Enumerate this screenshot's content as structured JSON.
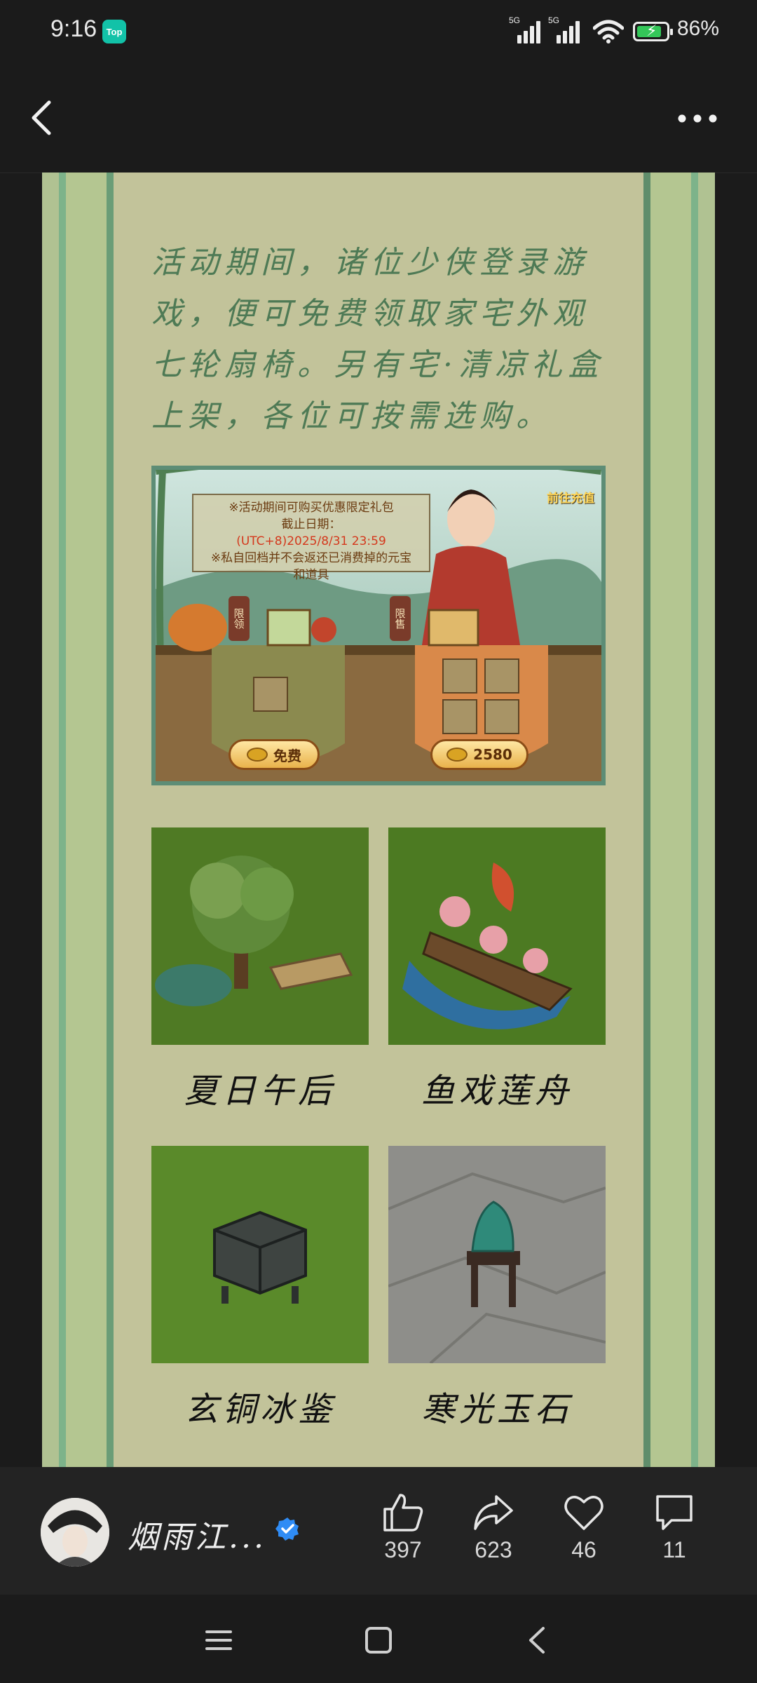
{
  "status_bar": {
    "time": "9:16",
    "app_badge": "Top",
    "signal_labels": [
      "5G",
      "5G"
    ],
    "battery_percent": "86%",
    "battery_level": 0.86,
    "charging": true
  },
  "poster": {
    "body_text": "活动期间，诸位少侠登录游戏，便可免费领取家宅外观七轮扇椅。另有宅·清凉礼盒上架，各位可按需选购。",
    "screenshot": {
      "notice_line1": "※活动期间可购买优惠限定礼包",
      "notice_line2": "截止日期：",
      "notice_line3": "(UTC+8)2025/8/31 23:59",
      "notice_line4": "※私自回档并不会返还已消费掉的元宝",
      "notice_line5": "和道具",
      "recharge_label": "前往充值",
      "tag_left": "限领",
      "tag_right": "限售",
      "free_label": "免费",
      "price_label": "2580"
    },
    "items": [
      {
        "label": "夏日午后"
      },
      {
        "label": "鱼戏莲舟"
      },
      {
        "label": "玄铜冰鉴"
      },
      {
        "label": "寒光玉石"
      }
    ],
    "colors": {
      "background": "#c2c39a",
      "text": "#4e7a55",
      "stripe": "#7db38a"
    }
  },
  "author": {
    "name": "烟雨江...",
    "verified": true
  },
  "actions": [
    {
      "icon": "thumbs-up-icon",
      "count": "397"
    },
    {
      "icon": "share-icon",
      "count": "623"
    },
    {
      "icon": "heart-icon",
      "count": "46"
    },
    {
      "icon": "comment-icon",
      "count": "11"
    }
  ]
}
